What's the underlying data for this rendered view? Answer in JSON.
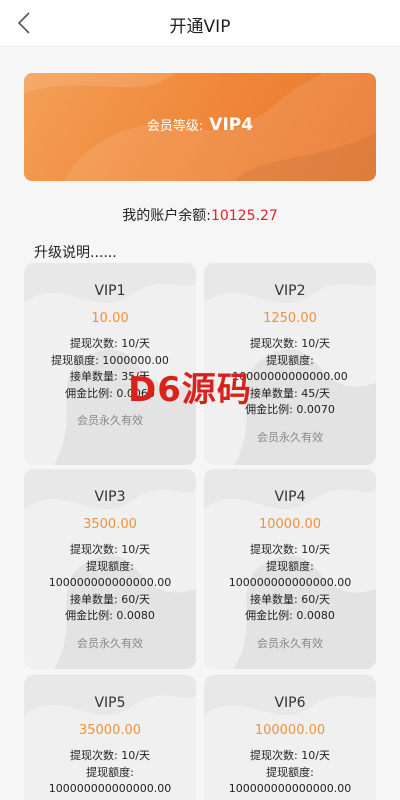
{
  "header": {
    "title": "开通VIP"
  },
  "banner": {
    "prefix": "会员等级:",
    "level": "VIP4"
  },
  "balance": {
    "label": "我的账户余额:",
    "amount": "10125.27"
  },
  "description_label": "升级说明......",
  "watermark": "D6源码",
  "cards": [
    {
      "name": "VIP1",
      "price": "10.00",
      "lines": [
        "提现次数: 10/天",
        "提现额度: 1000000.00",
        "接单数量: 35/天",
        "佣金比例: 0.0060"
      ],
      "footer": "会员永久有效"
    },
    {
      "name": "VIP2",
      "price": "1250.00",
      "lines": [
        "提现次数: 10/天",
        "提现额度:",
        "10000000000000.00",
        "接单数量: 45/天",
        "佣金比例: 0.0070"
      ],
      "footer": "会员永久有效"
    },
    {
      "name": "VIP3",
      "price": "3500.00",
      "lines": [
        "提现次数: 10/天",
        "提现额度:",
        "100000000000000.00",
        "接单数量: 60/天",
        "佣金比例: 0.0080"
      ],
      "footer": "会员永久有效"
    },
    {
      "name": "VIP4",
      "price": "10000.00",
      "lines": [
        "提现次数: 10/天",
        "提现额度:",
        "100000000000000.00",
        "接单数量: 60/天",
        "佣金比例: 0.0080"
      ],
      "footer": "会员永久有效"
    },
    {
      "name": "VIP5",
      "price": "35000.00",
      "lines": [
        "提现次数: 10/天",
        "提现额度:",
        "100000000000000.00"
      ],
      "footer": ""
    },
    {
      "name": "VIP6",
      "price": "100000.00",
      "lines": [
        "提现次数: 10/天",
        "提现额度:",
        "100000000000000.00"
      ],
      "footer": ""
    }
  ],
  "colors": {
    "accent": "#f08a3c",
    "price": "#f0923a",
    "balance_amount": "#e5202a"
  }
}
